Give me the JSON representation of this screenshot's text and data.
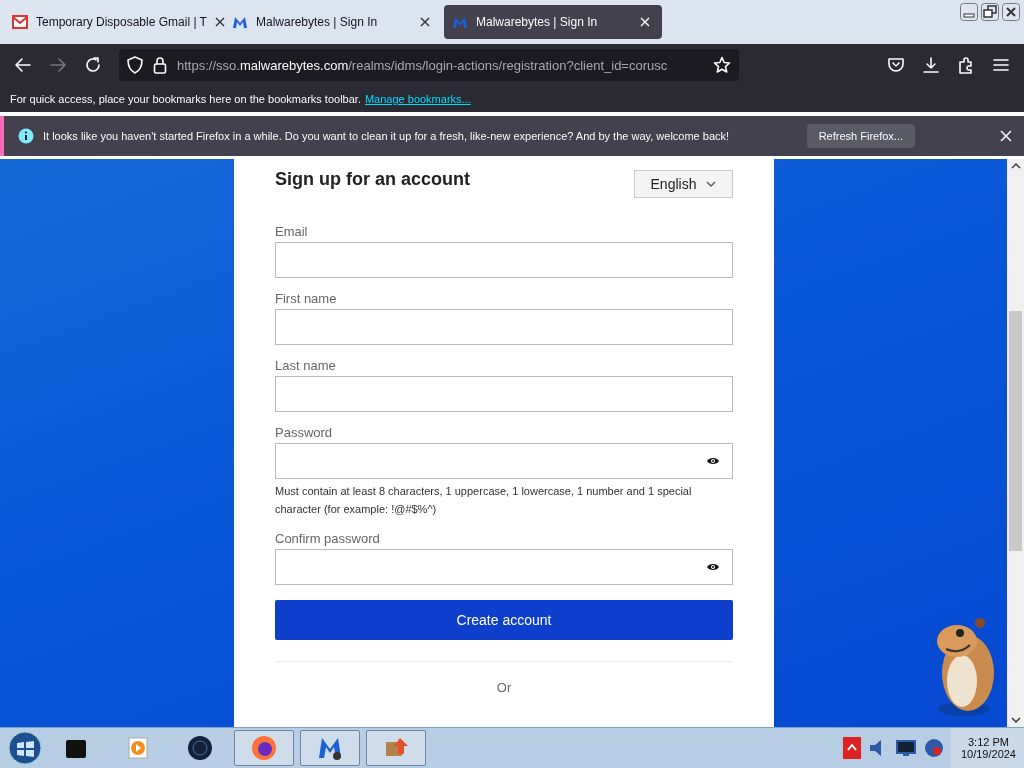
{
  "tabs": [
    {
      "title": "Temporary Disposable Gmail | T",
      "kind": "mail",
      "selected": false
    },
    {
      "title": "Malwarebytes | Sign In",
      "kind": "m",
      "selected": false
    },
    {
      "title": "Malwarebytes | Sign In",
      "kind": "m",
      "selected": true
    }
  ],
  "address": {
    "prefix": "https://sso.",
    "domain": "malwarebytes.com",
    "path": "/realms/idms/login-actions/registration?client_id=corusc"
  },
  "bookmarks_bar": {
    "text": "For quick access, place your bookmarks here on the bookmarks toolbar.",
    "link": "Manage bookmarks..."
  },
  "notification": {
    "text": "It looks like you haven't started Firefox in a while. Do you want to clean it up for a fresh, like-new experience? And by the way, welcome back!",
    "button": "Refresh Firefox..."
  },
  "form": {
    "title": "Sign up for an account",
    "language": "English",
    "fields": [
      {
        "label": "Email",
        "kind": "text"
      },
      {
        "label": "First name",
        "kind": "text"
      },
      {
        "label": "Last name",
        "kind": "text"
      },
      {
        "label": "Password",
        "kind": "password",
        "hint": "Must contain at least 8 characters, 1 uppercase, 1 lowercase, 1 number and 1 special character (for example: !@#$%^)"
      },
      {
        "label": "Confirm password",
        "kind": "password"
      }
    ],
    "submit": "Create account",
    "separator": "Or"
  },
  "taskbar": {
    "time": "3:12 PM",
    "date": "10/19/2024"
  }
}
